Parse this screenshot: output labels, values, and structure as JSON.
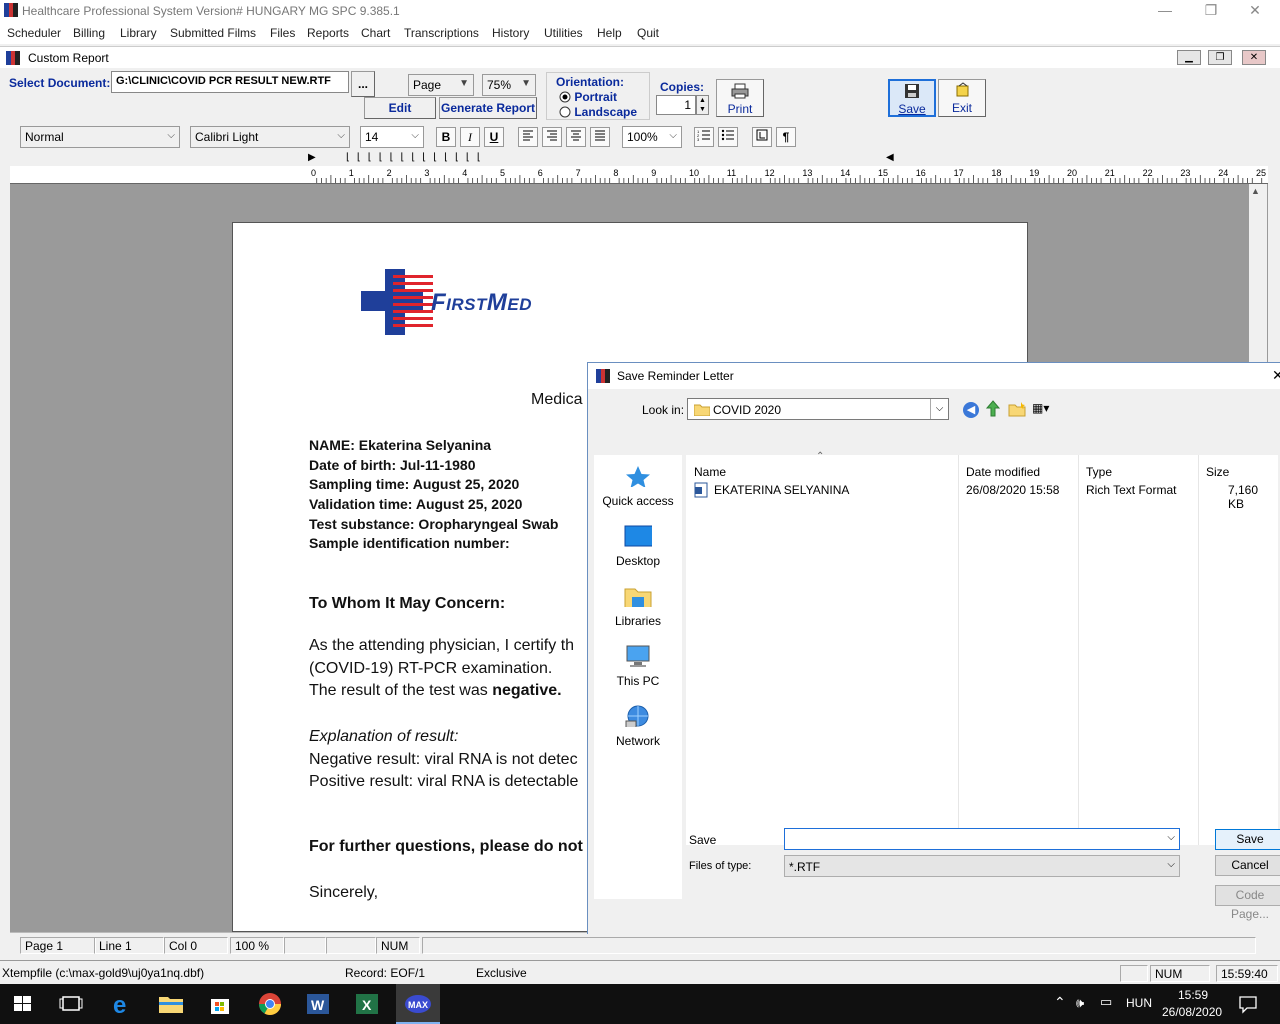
{
  "app": {
    "title": "Healthcare Professional System Version# HUNGARY MG  SPC 9.385.1",
    "window_controls": {
      "minimize": "—",
      "restore": "❐",
      "close": "✕"
    }
  },
  "menu": [
    "Scheduler",
    "Billing",
    "Library",
    "Submitted Films",
    "Files",
    "Reports",
    "Chart",
    "Transcriptions",
    "History",
    "Utilities",
    "Help",
    "Quit"
  ],
  "report_window": {
    "title": "Custom Report",
    "select_document_label": "Select Document:",
    "select_document_value": "G:\\CLINIC\\COVID PCR RESULT NEW.RTF",
    "browse_label": "...",
    "view_mode": "Page",
    "zoom": "75%",
    "edit_label": "Edit",
    "generate_label": "Generate Report",
    "orientation_label": "Orientation:",
    "portrait_label": "Portrait",
    "landscape_label": "Landscape",
    "orientation_selected": "Portrait",
    "copies_label": "Copies:",
    "copies_value": "1",
    "print_label": "Print",
    "save_label": "Save",
    "exit_label": "Exit"
  },
  "format": {
    "style": "Normal",
    "font": "Calibri Light",
    "size": "14",
    "bold": "B",
    "italic": "I",
    "underline": "U",
    "zoom": "100%",
    "pilcrow": "¶"
  },
  "ruler_numbers": [
    "0",
    "1",
    "2",
    "3",
    "4",
    "5",
    "6",
    "7",
    "8",
    "9",
    "10",
    "11",
    "12",
    "13",
    "14",
    "15",
    "16",
    "17",
    "18",
    "19",
    "20",
    "21",
    "22",
    "23",
    "24",
    "25"
  ],
  "document": {
    "logo_text": "FirstMed",
    "heading": "Medica",
    "fields": [
      "NAME:  Ekaterina  Selyanina",
      "Date of birth: Jul-11-1980",
      "Sampling time: August 25, 2020",
      "Validation time:  August 25, 2020",
      "Test substance: Oropharyngeal Swab",
      "Sample identification number:"
    ],
    "salutation": "To Whom It May Concern:",
    "para1_line1": "As the attending physician, I certify th",
    "para1_line2": "(COVID-19) RT-PCR   examination.",
    "result_prefix": "The result of the test was ",
    "result_value": "negative.",
    "explanation_heading": "Explanation of result:",
    "negative_line": "Negative result: viral RNA is not detec",
    "positive_line": "Positive result: viral RNA is detectable",
    "further": "For further questions, please do not",
    "closing": "Sincerely,"
  },
  "doc_status": {
    "page": "Page   1",
    "line": "Line   1",
    "col": "Col   0",
    "zoom": "100 %",
    "num": "NUM"
  },
  "app_status": {
    "tempfile": "Xtempfile (c:\\max-gold9\\uj0ya1nq.dbf)",
    "record": "Record: EOF/1",
    "mode": "Exclusive",
    "num": "NUM",
    "clock": "15:59:40"
  },
  "save_dialog": {
    "title": "Save Reminder Letter",
    "look_in_label": "Look in:",
    "look_in_value": "COVID 2020",
    "places": [
      "Quick access",
      "Desktop",
      "Libraries",
      "This PC",
      "Network"
    ],
    "columns": [
      "Name",
      "Date modified",
      "Type",
      "Size"
    ],
    "files": [
      {
        "name": "EKATERINA SELYANINA",
        "modified": "26/08/2020 15:58",
        "type": "Rich Text Format",
        "size": "7,160 KB"
      }
    ],
    "save_label": "Save",
    "save_value": "",
    "type_label": "Files of type:",
    "type_value": "*.RTF",
    "save_button": "Save",
    "cancel_button": "Cancel",
    "codepage_button": "Code Page..."
  },
  "taskbar": {
    "lang": "HUN",
    "time": "15:59",
    "date": "26/08/2020"
  },
  "colors": {
    "accent_blue": "#0a2a9c",
    "logo_blue": "#1f3f9a",
    "logo_red": "#e0242c"
  }
}
